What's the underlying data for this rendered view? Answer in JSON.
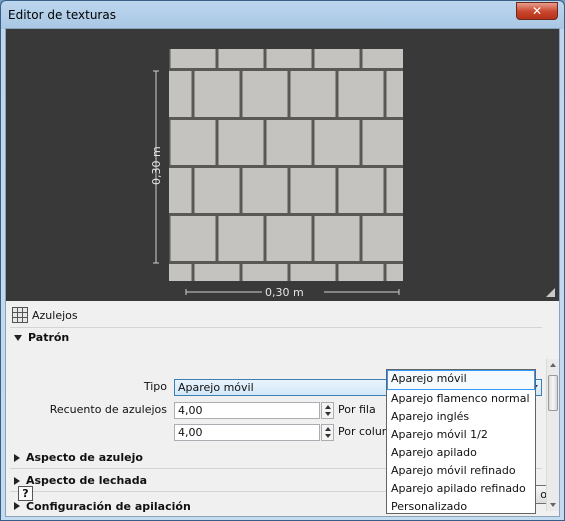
{
  "window": {
    "title": "Editor de texturas",
    "close_label": "✕"
  },
  "preview": {
    "height_label": "0,30 m",
    "width_label": "0,30 m"
  },
  "panel": {
    "material_title": "Azulejos",
    "help_label": "?",
    "ok_label": "o",
    "pattern": {
      "heading": "Patrón",
      "type_label": "Tipo",
      "type_value": "Aparejo móvil",
      "count_label": "Recuento de azulejos",
      "per_row_value": "4,00",
      "per_row_label": "Por fila",
      "per_column_value": "4,00",
      "per_column_label": "Por colum"
    },
    "sections": [
      {
        "label": "Aspecto de azulejo"
      },
      {
        "label": "Aspecto de lechada"
      },
      {
        "label": "Configuración de apilación"
      }
    ]
  },
  "dropdown": {
    "options": [
      "Aparejo móvil",
      "Aparejo flamenco normal",
      "Aparejo inglés",
      "Aparejo móvil 1/2",
      "Aparejo apilado",
      "Aparejo móvil refinado",
      "Aparejo apilado refinado",
      "Personalizado"
    ],
    "selected_index": 0
  }
}
